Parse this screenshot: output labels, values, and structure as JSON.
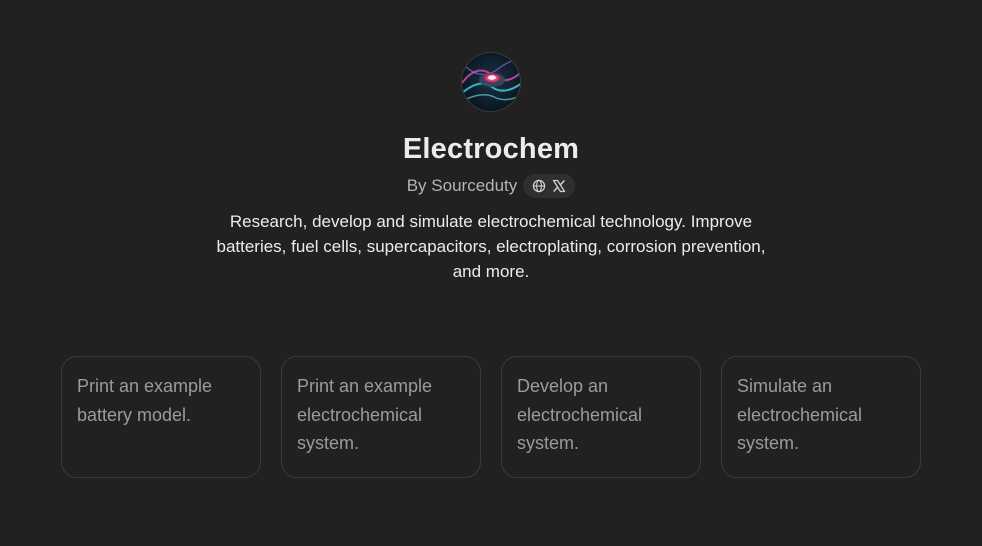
{
  "gpt": {
    "avatar_icon": "electrochem-avatar-icon",
    "name": "Electrochem",
    "byline": "By Sourceduty",
    "social_icons": [
      "globe-icon",
      "x-logo-icon"
    ],
    "description": "Research, develop and simulate electrochemical technology. Improve batteries, fuel cells, supercapacitors, electroplating, corrosion prevention, and more."
  },
  "starters": [
    {
      "label": "Print an example battery model."
    },
    {
      "label": "Print an example electrochemical system."
    },
    {
      "label": "Develop an electrochemical system."
    },
    {
      "label": "Simulate an electrochemical system."
    }
  ],
  "colors": {
    "background": "#212121",
    "text_primary": "#ececec",
    "text_secondary": "#b4b4b4",
    "card_border": "#3a3a3a",
    "card_text": "#9b9b9b"
  }
}
